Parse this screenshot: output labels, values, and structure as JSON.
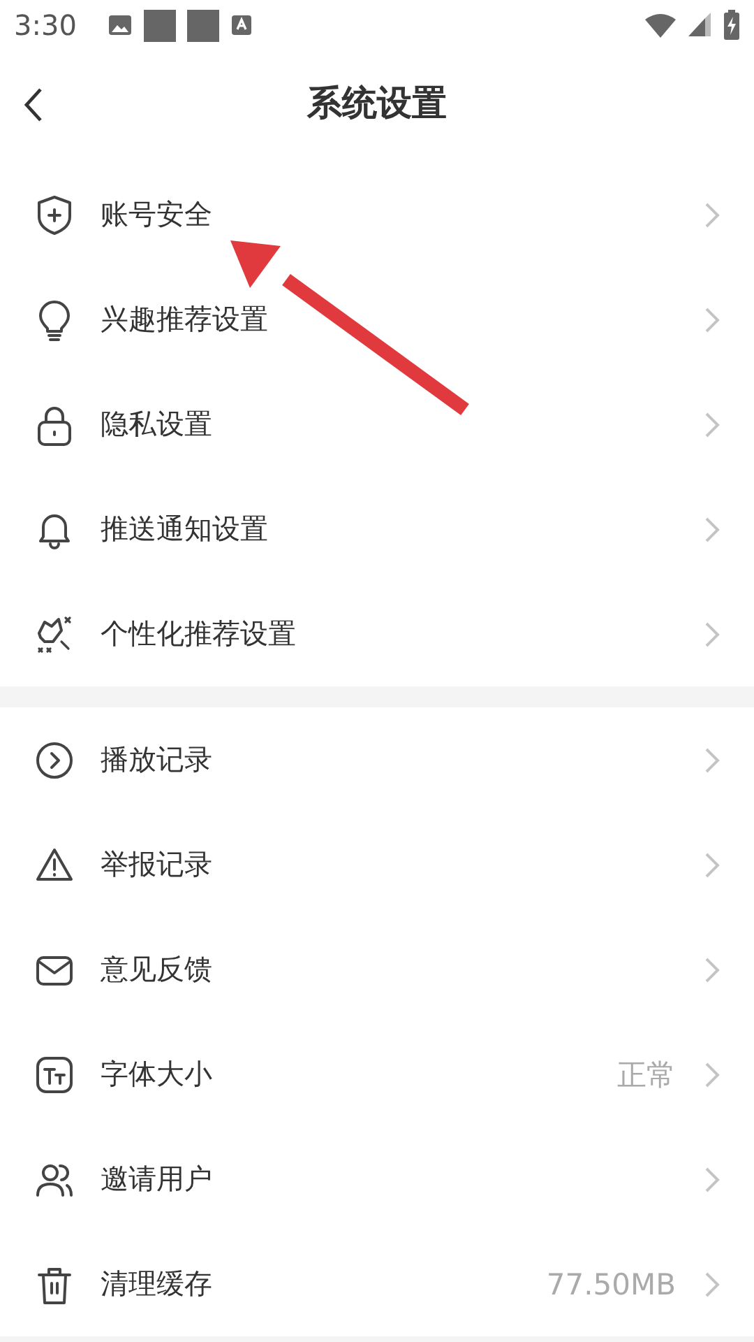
{
  "status_bar": {
    "time": "3:30"
  },
  "header": {
    "title": "系统设置"
  },
  "groups": [
    {
      "items": [
        {
          "label": "账号安全"
        },
        {
          "label": "兴趣推荐设置"
        },
        {
          "label": "隐私设置"
        },
        {
          "label": "推送通知设置"
        },
        {
          "label": "个性化推荐设置"
        }
      ]
    },
    {
      "items": [
        {
          "label": "播放记录"
        },
        {
          "label": "举报记录"
        },
        {
          "label": "意见反馈"
        },
        {
          "label": "字体大小",
          "value": "正常"
        },
        {
          "label": "邀请用户"
        },
        {
          "label": "清理缓存",
          "value": "77.50MB"
        }
      ]
    }
  ]
}
